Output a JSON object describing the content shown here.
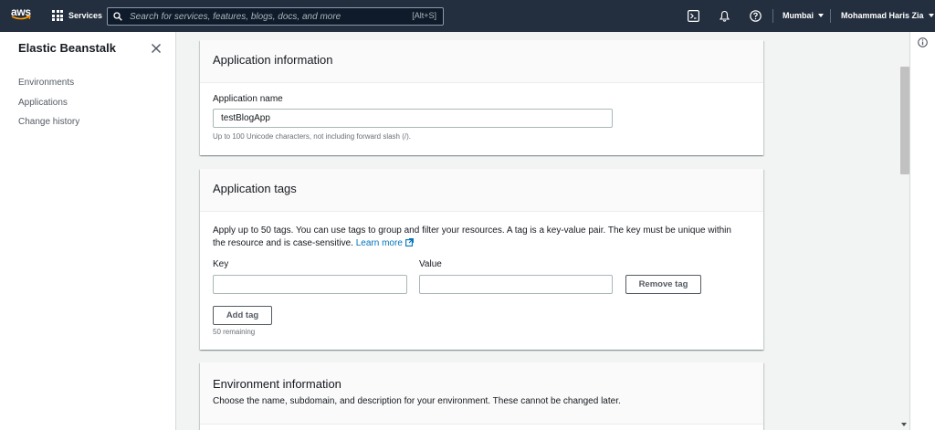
{
  "topnav": {
    "logo_text": "aws",
    "services_label": "Services",
    "search_placeholder": "Search for services, features, blogs, docs, and more",
    "search_shortcut": "[Alt+S]",
    "region": "Mumbai",
    "user": "Mohammad Haris Zia"
  },
  "sidebar": {
    "title": "Elastic Beanstalk",
    "items": [
      {
        "label": "Environments"
      },
      {
        "label": "Applications"
      },
      {
        "label": "Change history"
      }
    ]
  },
  "app_info": {
    "header": "Application information",
    "name_label": "Application name",
    "name_value": "testBlogApp",
    "name_hint": "Up to 100 Unicode characters, not including forward slash (/)."
  },
  "app_tags": {
    "header": "Application tags",
    "description": "Apply up to 50 tags. You can use tags to group and filter your resources. A tag is a key-value pair. The key must be unique within the resource and is case-sensitive.",
    "learn_more": "Learn more",
    "key_label": "Key",
    "value_label": "Value",
    "key_value": "",
    "value_value": "",
    "remove_button": "Remove tag",
    "add_button": "Add tag",
    "remaining": "50 remaining"
  },
  "env_info": {
    "header": "Environment information",
    "description": "Choose the name, subdomain, and description for your environment. These cannot be changed later."
  },
  "colors": {
    "nav_bg": "#232f3e",
    "link": "#0073bb",
    "page_bg": "#f2f3f3"
  }
}
